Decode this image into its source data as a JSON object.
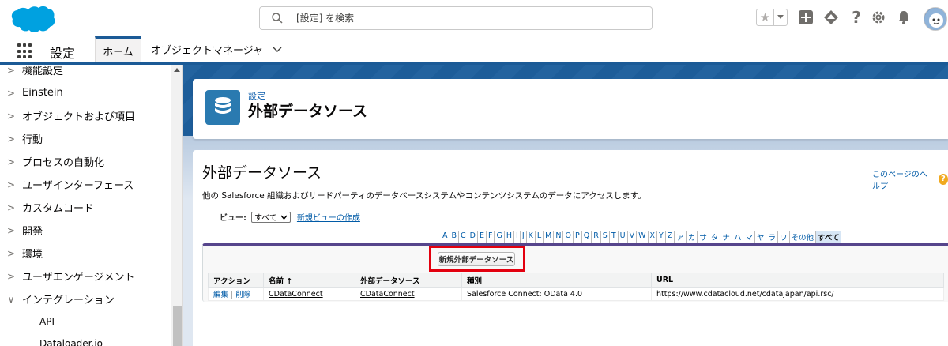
{
  "header": {
    "search_placeholder": "[設定] を検索",
    "icons": [
      "salesforce-cloud-logo",
      "search-icon",
      "favorites-star-icon",
      "chevron-down-icon",
      "add-icon",
      "trailhead-icon",
      "help-icon",
      "gear-icon",
      "bell-icon",
      "avatar"
    ]
  },
  "context": {
    "app_name": "設定",
    "tabs": [
      {
        "label": "ホーム",
        "active": true
      },
      {
        "label": "オブジェクトマネージャ",
        "active": false
      }
    ]
  },
  "sidebar": {
    "items": [
      {
        "label": "機能設定",
        "expanded": false
      },
      {
        "label": "Einstein",
        "expanded": false
      },
      {
        "label": "オブジェクトおよび項目",
        "expanded": false
      },
      {
        "label": "行動",
        "expanded": false
      },
      {
        "label": "プロセスの自動化",
        "expanded": false
      },
      {
        "label": "ユーザインターフェース",
        "expanded": false
      },
      {
        "label": "カスタムコード",
        "expanded": false
      },
      {
        "label": "開発",
        "expanded": false
      },
      {
        "label": "環境",
        "expanded": false
      },
      {
        "label": "ユーザエンゲージメント",
        "expanded": false
      },
      {
        "label": "インテグレーション",
        "expanded": true
      }
    ],
    "children": [
      "API",
      "Dataloader.io"
    ]
  },
  "page_header": {
    "breadcrumb": "設定",
    "title": "外部データソース"
  },
  "content": {
    "title": "外部データソース",
    "help_label": "このページのヘルプ",
    "description": "他の Salesforce 組織およびサードパーティのデータベースシステムやコンテンツシステムのデータにアクセスします。",
    "view_label": "ビュー:",
    "view_selected": "すべて",
    "new_view_label": "新規ビューの作成",
    "alphabet": [
      "A",
      "B",
      "C",
      "D",
      "E",
      "F",
      "G",
      "H",
      "I",
      "J",
      "K",
      "L",
      "M",
      "N",
      "O",
      "P",
      "Q",
      "R",
      "S",
      "T",
      "U",
      "V",
      "W",
      "X",
      "Y",
      "Z",
      "ア",
      "カ",
      "サ",
      "タ",
      "ナ",
      "ハ",
      "マ",
      "ヤ",
      "ラ",
      "ワ",
      "その他",
      "すべて"
    ],
    "alphabet_selected": "すべて",
    "new_button_label": "新規外部データソース",
    "table": {
      "columns": [
        "アクション",
        "名前 ↑",
        "外部データソース",
        "種別",
        "URL"
      ],
      "rows": [
        {
          "edit": "編集",
          "separator": "|",
          "delete": "削除",
          "name": "CDataConnect",
          "external_source": "CDataConnect",
          "type": "Salesforce Connect: OData 4.0",
          "url": "https://www.cdatacloud.net/cdatajapan/api.rsc/"
        }
      ]
    }
  },
  "colors": {
    "brand_blue": "#1b5a96",
    "link_blue": "#015ba7",
    "highlight_red": "#e3000f",
    "icon_blue": "#2a7ab0"
  }
}
